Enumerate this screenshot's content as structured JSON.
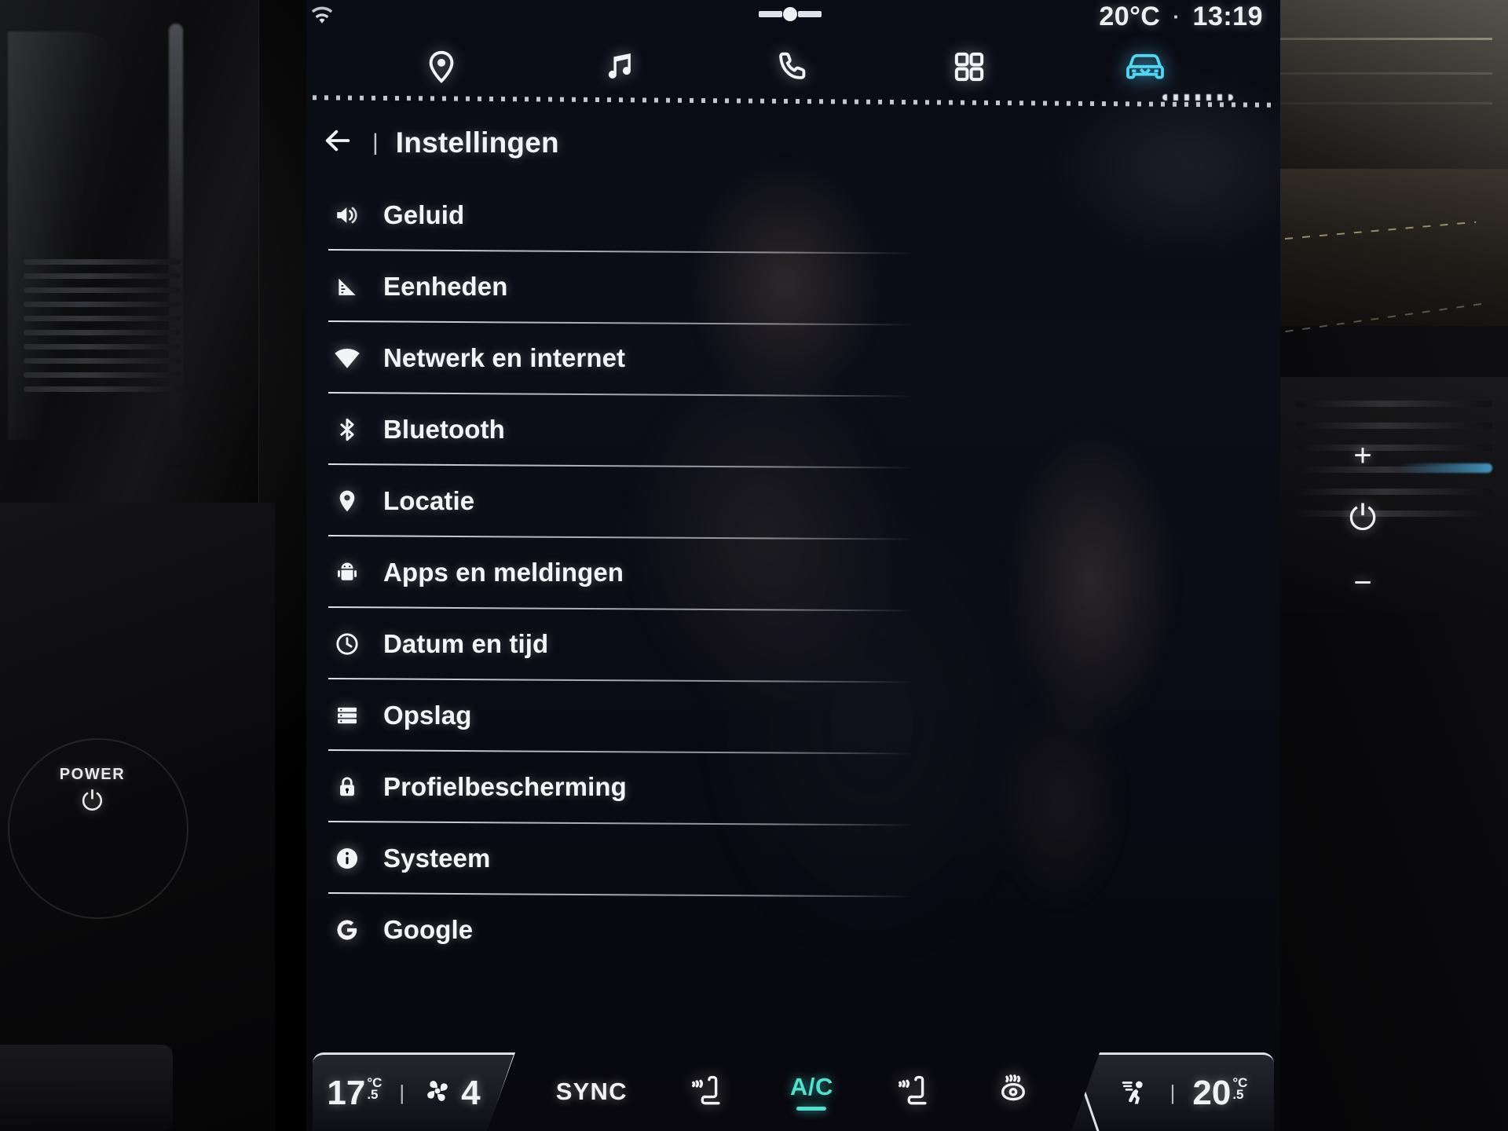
{
  "car_dashboard": {
    "power_knob": {
      "label": "POWER",
      "icon": "power-icon",
      "glyph": "⏻"
    },
    "bezel_keys": {
      "volume_up": "+",
      "power": "⏻",
      "volume_down": "−"
    }
  },
  "screen": {
    "status_bar": {
      "wifi_icon": "wifi-icon",
      "pull_handle_icon": "drag-handle-icon",
      "outside_temperature": "20°C",
      "separator": "·",
      "clock": "13:19"
    },
    "top_nav": {
      "tabs": [
        {
          "id": "navigation",
          "icon": "map-pin-icon",
          "label": "Navigatie",
          "active": false
        },
        {
          "id": "media",
          "icon": "music-note-icon",
          "label": "Media",
          "active": false
        },
        {
          "id": "phone",
          "icon": "phone-icon",
          "label": "Telefoon",
          "active": false
        },
        {
          "id": "apps",
          "icon": "grid-apps-icon",
          "label": "Apps",
          "active": false
        },
        {
          "id": "vehicle",
          "icon": "car-front-icon",
          "label": "Voertuig",
          "active": true
        }
      ],
      "active_color": "#4fd8f5"
    },
    "page_header": {
      "back_icon": "arrow-left-icon",
      "pipe": "|",
      "title": "Instellingen"
    },
    "settings_list": [
      {
        "label": "Geluid",
        "icon": "speaker-icon"
      },
      {
        "label": "Eenheden",
        "icon": "ruler-icon"
      },
      {
        "label": "Netwerk en internet",
        "icon": "wifi-icon"
      },
      {
        "label": "Bluetooth",
        "icon": "bluetooth-icon"
      },
      {
        "label": "Locatie",
        "icon": "map-pin-icon"
      },
      {
        "label": "Apps en meldingen",
        "icon": "android-robot-icon"
      },
      {
        "label": "Datum en tijd",
        "icon": "clock-icon"
      },
      {
        "label": "Opslag",
        "icon": "storage-icon"
      },
      {
        "label": "Profielbescherming",
        "icon": "lock-icon"
      },
      {
        "label": "Systeem",
        "icon": "info-circle-icon"
      },
      {
        "label": "Google",
        "icon": "google-g-icon"
      }
    ],
    "climate_bar": {
      "left": {
        "temperature_whole": "17",
        "temperature_unit": "°C",
        "temperature_frac": ".5",
        "divider": "|",
        "fan_icon": "fan-icon",
        "fan_speed": "4"
      },
      "center_buttons": [
        {
          "id": "sync",
          "label": "SYNC",
          "icon": "text-label",
          "active": false
        },
        {
          "id": "seat-heat-left",
          "label": "",
          "icon": "heated-seat-icon",
          "active": false
        },
        {
          "id": "ac",
          "label": "A/C",
          "icon": "text-label",
          "active": true
        },
        {
          "id": "seat-heat-right",
          "label": "",
          "icon": "heated-seat-icon",
          "active": false
        },
        {
          "id": "defrost-rear",
          "label": "",
          "icon": "rear-defrost-icon",
          "active": false
        }
      ],
      "right": {
        "airflow_icon": "airflow-person-icon",
        "divider": "|",
        "temperature_whole": "20",
        "temperature_unit": "°C",
        "temperature_frac": ".5"
      },
      "active_color": "#4fe2d0"
    }
  }
}
